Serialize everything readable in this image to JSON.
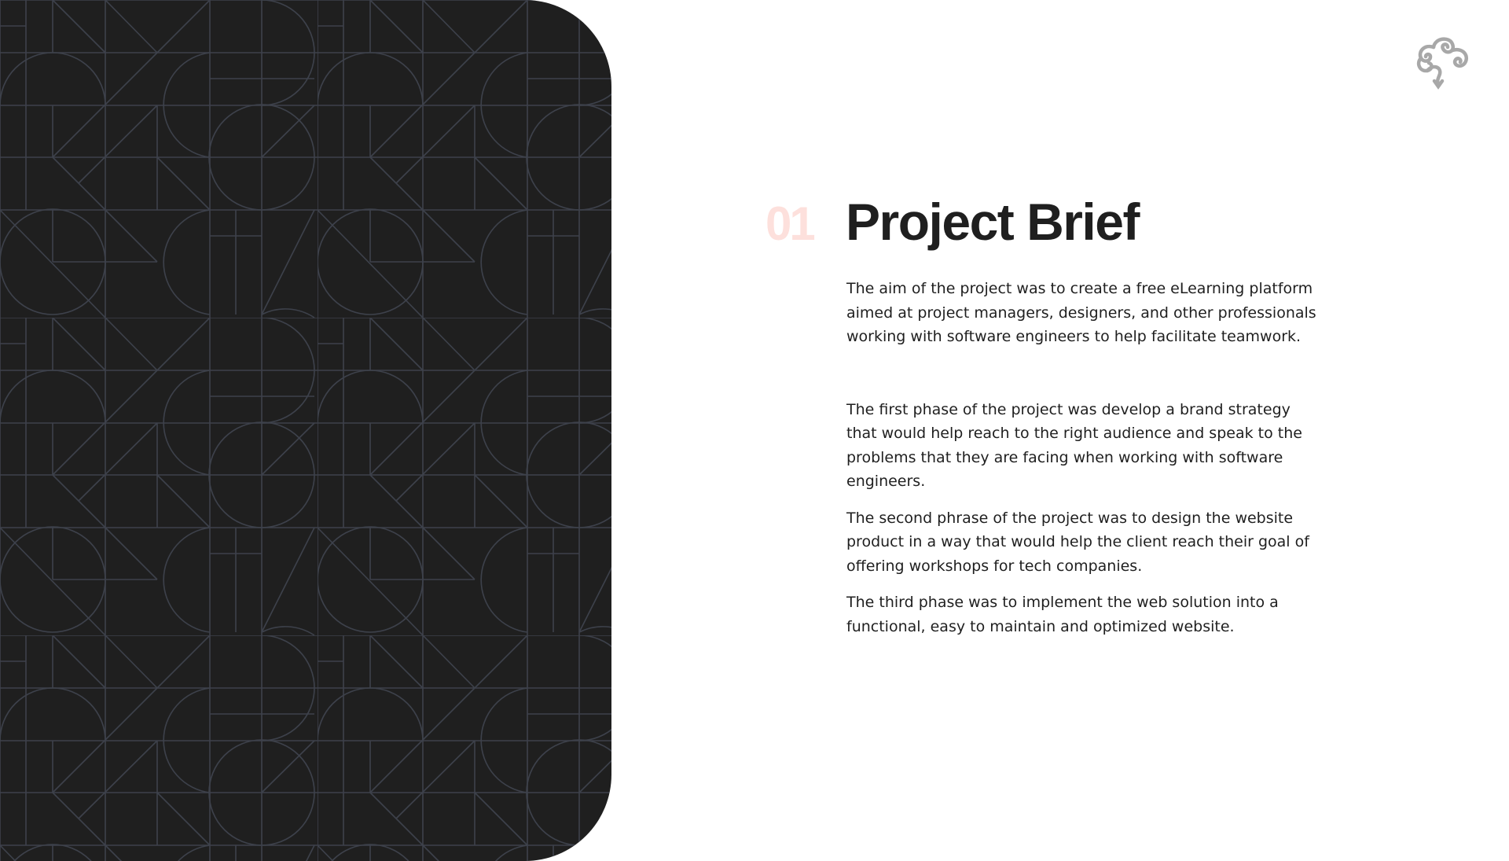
{
  "brand": {
    "logo_icon": "cloud-swirl-icon",
    "logo_color": "#a8a8a8"
  },
  "colors": {
    "panel_bg": "#1f1f1f",
    "pattern_line": "#3d414b",
    "number_accent": "#fde0dc",
    "text": "#1f1f1f"
  },
  "section": {
    "number": "01",
    "title": "Project Brief",
    "paragraphs": [
      "The aim of the project was to create a free eLearning platform aimed at project managers, designers, and other professionals working with software engineers to help facilitate teamwork.",
      "The first phase of the project was develop a brand strategy that would help reach to the right audience and speak to the problems that they are facing when working with software engineers.",
      "The second phrase of the project was to design the website product in a way that would help the client reach their goal of offering workshops for tech companies.",
      "The third phase was to implement the web solution into a functional, easy to maintain and optimized website."
    ]
  }
}
